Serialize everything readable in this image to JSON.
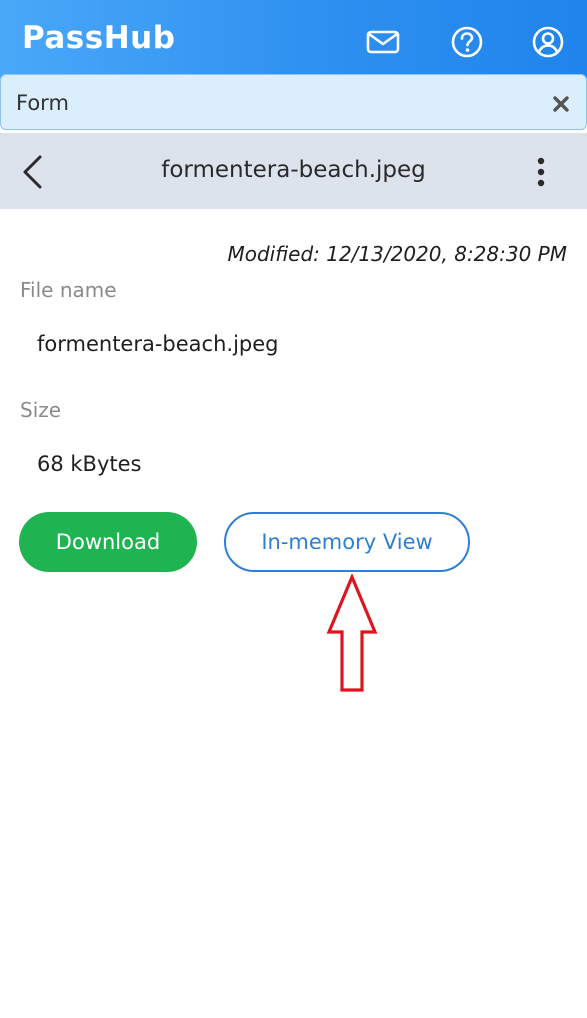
{
  "header": {
    "app_name": "PassHub",
    "icons": [
      "mail-icon",
      "help-icon",
      "account-icon"
    ],
    "accent_color": "#2e90f0"
  },
  "search": {
    "value": "Form",
    "close_icon": "close-icon"
  },
  "title_bar": {
    "title": "formentera-beach.jpeg",
    "back_icon": "chevron-left-icon",
    "menu_icon": "more-vertical-icon"
  },
  "file": {
    "modified": "Modified: 12/13/2020, 8:28:30 PM",
    "name_label": "File name",
    "name_value": "formentera-beach.jpeg",
    "size_label": "Size",
    "size_value": "68 kBytes"
  },
  "actions": {
    "download_label": "Download",
    "view_label": "In-memory View",
    "download_color": "#1fb351",
    "view_color": "#2f7fd3"
  },
  "annotation": {
    "icon": "arrow-up-icon",
    "color": "#e0141e"
  }
}
